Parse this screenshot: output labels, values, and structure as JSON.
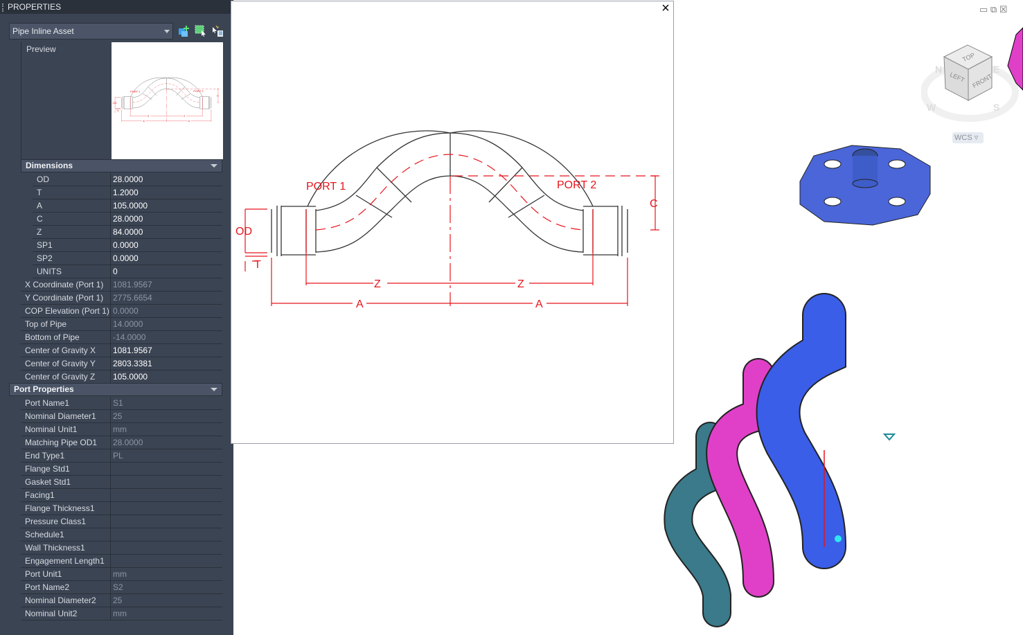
{
  "panel": {
    "title": "PROPERTIES",
    "selector": "Pipe Inline Asset",
    "preview_label": "Preview"
  },
  "sections": {
    "dimensions": "Dimensions",
    "ports": "Port Properties"
  },
  "dimensions": [
    {
      "label": "OD",
      "value": "28.0000",
      "style": "bright"
    },
    {
      "label": "T",
      "value": "1.2000",
      "style": "bright"
    },
    {
      "label": "A",
      "value": "105.0000",
      "style": "bright"
    },
    {
      "label": "C",
      "value": "28.0000",
      "style": "bright"
    },
    {
      "label": "Z",
      "value": "84.0000",
      "style": "bright"
    },
    {
      "label": "SP1",
      "value": "0.0000",
      "style": "bright"
    },
    {
      "label": "SP2",
      "value": "0.0000",
      "style": "bright"
    },
    {
      "label": "UNITS",
      "value": "0",
      "style": "bright"
    }
  ],
  "general": [
    {
      "label": "X Coordinate (Port 1)",
      "value": "1081.9567",
      "style": "dim"
    },
    {
      "label": "Y Coordinate (Port 1)",
      "value": "2775.6654",
      "style": "dim"
    },
    {
      "label": "COP Elevation (Port 1)",
      "value": "0.0000",
      "style": "dim"
    },
    {
      "label": "Top of Pipe",
      "value": "14.0000",
      "style": "dim"
    },
    {
      "label": "Bottom of Pipe",
      "value": "-14.0000",
      "style": "dim"
    },
    {
      "label": "Center of Gravity X",
      "value": "1081.9567",
      "style": "bright"
    },
    {
      "label": "Center of Gravity Y",
      "value": "2803.3381",
      "style": "bright"
    },
    {
      "label": "Center of Gravity Z",
      "value": "105.0000",
      "style": "bright"
    }
  ],
  "ports": [
    {
      "label": "Port Name1",
      "value": "S1",
      "style": "dim"
    },
    {
      "label": "Nominal Diameter1",
      "value": "25",
      "style": "dim"
    },
    {
      "label": "Nominal Unit1",
      "value": "mm",
      "style": "dim"
    },
    {
      "label": "Matching Pipe OD1",
      "value": "28.0000",
      "style": "dim"
    },
    {
      "label": "End Type1",
      "value": "PL",
      "style": "dim"
    },
    {
      "label": "Flange Std1",
      "value": "",
      "style": "dim"
    },
    {
      "label": "Gasket Std1",
      "value": "",
      "style": "dim"
    },
    {
      "label": "Facing1",
      "value": "",
      "style": "dim"
    },
    {
      "label": "Flange Thickness1",
      "value": "",
      "style": "dim"
    },
    {
      "label": "Pressure Class1",
      "value": "",
      "style": "dim"
    },
    {
      "label": "Schedule1",
      "value": "",
      "style": "dim"
    },
    {
      "label": "Wall Thickness1",
      "value": "",
      "style": "dim"
    },
    {
      "label": "Engagement Length1",
      "value": "",
      "style": "dim"
    },
    {
      "label": "Port Unit1",
      "value": "mm",
      "style": "dim"
    },
    {
      "label": "Port Name2",
      "value": "S2",
      "style": "dim"
    },
    {
      "label": "Nominal Diameter2",
      "value": "25",
      "style": "dim"
    },
    {
      "label": "Nominal Unit2",
      "value": "mm",
      "style": "dim"
    }
  ],
  "drawing": {
    "port1": "PORT 1",
    "port2": "PORT 2",
    "od": "OD",
    "t": "T",
    "c": "C",
    "z": "Z",
    "a": "A"
  },
  "popup": {
    "close": "×"
  },
  "viewcube": {
    "top": "TOP",
    "left": "LEFT",
    "front": "FRONT",
    "n": "N",
    "e": "E",
    "s": "S",
    "w": "W",
    "wcs": "WCS"
  },
  "window_controls": {
    "min": "▭",
    "restore": "⧉",
    "close": "☒"
  },
  "colors": {
    "panel": "#3b4453",
    "dim_red": "#e8141c",
    "pipe_blue": "#3a5ee8",
    "pipe_magenta": "#e040c8"
  }
}
